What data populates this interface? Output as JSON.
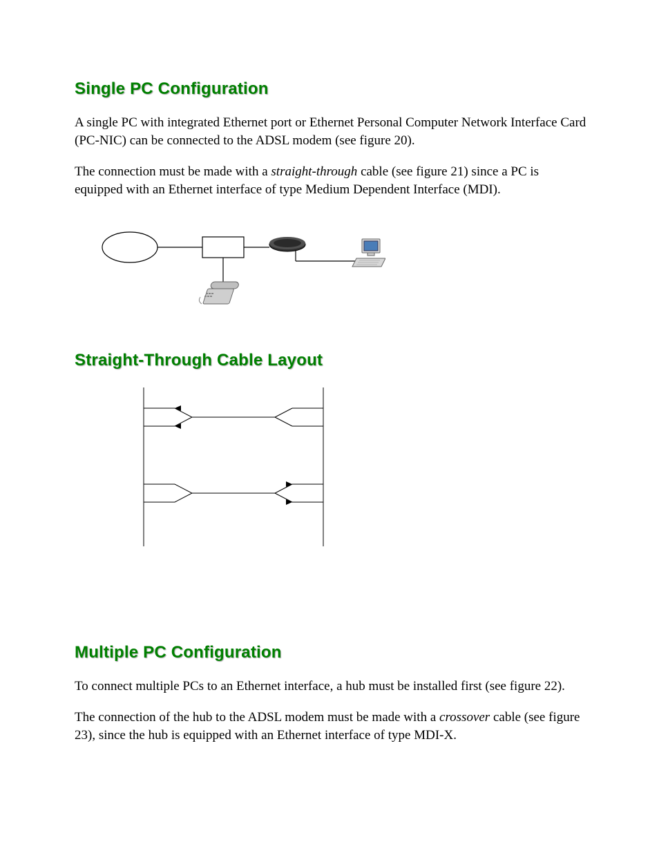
{
  "sections": {
    "single_pc": {
      "heading": "Single PC Configuration",
      "p1_a": "A single PC with integrated Ethernet port or Ethernet Personal Computer Network Interface Card (PC-NIC) can be connected to the ADSL modem (see figure 20).",
      "p2_a": "The connection must be made with a ",
      "p2_em": "straight-through",
      "p2_b": " cable (see figure 21) since a PC is equipped with an Ethernet interface of type Medium Dependent Interface (MDI)."
    },
    "cable": {
      "heading": "Straight-Through Cable Layout"
    },
    "multi_pc": {
      "heading": "Multiple PC Configuration",
      "p1": "To connect multiple PCs to an Ethernet interface, a hub must be installed first (see figure 22).",
      "p2_a": "The connection of the hub to the ADSL modem must be made with a ",
      "p2_em": "crossover",
      "p2_b": " cable (see figure 23), since the hub is equipped with an Ethernet interface of type MDI-X."
    }
  }
}
